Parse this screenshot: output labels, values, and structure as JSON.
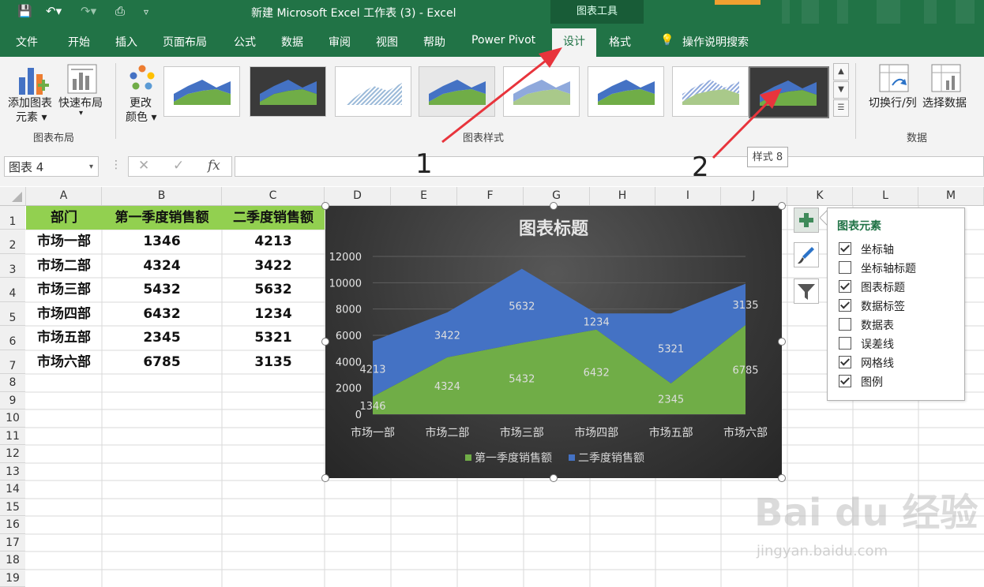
{
  "window": {
    "title": "新建 Microsoft Excel 工作表 (3)  -  Excel",
    "tools_tab": "图表工具"
  },
  "tabs": [
    "文件",
    "开始",
    "插入",
    "页面布局",
    "公式",
    "数据",
    "审阅",
    "视图",
    "帮助",
    "Power Pivot",
    "设计",
    "格式",
    "操作说明搜索"
  ],
  "ribbon": {
    "add_element": "添加图表",
    "add_element_2": "元素",
    "quick_layout": "快速布局",
    "change_color": "更改",
    "change_color_2": "颜色",
    "group_layout": "图表布局",
    "group_styles": "图表样式",
    "switch_row_col": "切换行/列",
    "select_data": "选择数据",
    "group_data": "数据",
    "tooltip": "样式 8"
  },
  "formula_bar": {
    "name_box": "图表 4",
    "fx": "fx"
  },
  "grid": {
    "columns": [
      "A",
      "B",
      "C",
      "D",
      "E",
      "F",
      "G",
      "H",
      "I",
      "J",
      "K",
      "L",
      "M"
    ],
    "rows": [
      "1",
      "2",
      "3",
      "4",
      "5",
      "6",
      "7",
      "8",
      "9",
      "10",
      "11",
      "12",
      "13",
      "14",
      "15",
      "16",
      "17",
      "18",
      "19"
    ],
    "headers": [
      "部门",
      "第一季度销售额",
      "二季度销售额"
    ],
    "data": [
      [
        "市场一部",
        "1346",
        "4213"
      ],
      [
        "市场二部",
        "4324",
        "3422"
      ],
      [
        "市场三部",
        "5432",
        "5632"
      ],
      [
        "市场四部",
        "6432",
        "1234"
      ],
      [
        "市场五部",
        "2345",
        "5321"
      ],
      [
        "市场六部",
        "6785",
        "3135"
      ]
    ]
  },
  "chart_data": {
    "type": "area",
    "stacked": true,
    "title": "图表标题",
    "categories": [
      "市场一部",
      "市场二部",
      "市场三部",
      "市场四部",
      "市场五部",
      "市场六部"
    ],
    "series": [
      {
        "name": "第一季度销售额",
        "values": [
          1346,
          4324,
          5432,
          6432,
          2345,
          6785
        ],
        "color": "#70ad47"
      },
      {
        "name": "二季度销售额",
        "values": [
          4213,
          3422,
          5632,
          1234,
          5321,
          3135
        ],
        "color": "#4472c4"
      }
    ],
    "y_ticks": [
      "0",
      "2000",
      "4000",
      "6000",
      "8000",
      "10000",
      "12000"
    ],
    "ylim": [
      0,
      12000
    ],
    "grid": true,
    "legend": "bottom",
    "data_labels": true
  },
  "elements_panel": {
    "title": "图表元素",
    "items": [
      {
        "label": "坐标轴",
        "checked": true
      },
      {
        "label": "坐标轴标题",
        "checked": false
      },
      {
        "label": "图表标题",
        "checked": true
      },
      {
        "label": "数据标签",
        "checked": true
      },
      {
        "label": "数据表",
        "checked": false
      },
      {
        "label": "误差线",
        "checked": false
      },
      {
        "label": "网格线",
        "checked": true
      },
      {
        "label": "图例",
        "checked": true
      }
    ]
  },
  "annotations": {
    "step1": "1",
    "step2": "2"
  },
  "watermark": {
    "brand": "Bai du 经验",
    "url": "jingyan.baidu.com"
  },
  "colors": {
    "excel_green": "#217346",
    "header_fill": "#92d050",
    "arrow_red": "#e8343c"
  }
}
